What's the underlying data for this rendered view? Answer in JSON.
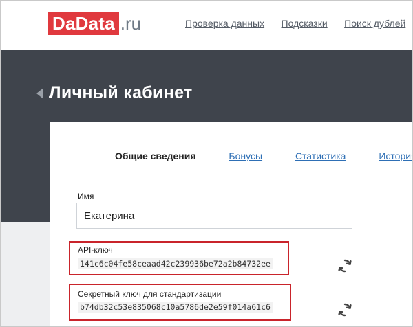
{
  "header": {
    "logo_main": "DaData",
    "logo_suffix": ".ru",
    "nav": [
      "Проверка данных",
      "Подсказки",
      "Поиск дублей"
    ]
  },
  "page": {
    "title": "Личный кабинет"
  },
  "tabs": [
    {
      "label": "Общие сведения",
      "active": true
    },
    {
      "label": "Бонусы",
      "active": false
    },
    {
      "label": "Статистика",
      "active": false
    },
    {
      "label": "История",
      "active": false
    }
  ],
  "form": {
    "name_label": "Имя",
    "name_value": "Екатерина",
    "api_key_label": "API-ключ",
    "api_key_value": "141c6c04fe58ceaad42c239936be72a2b84732ee",
    "secret_key_label": "Секретный ключ для стандартизации",
    "secret_key_value": "b74db32c53e835068c10a5786de2e59f014a61c6"
  },
  "colors": {
    "brand_red": "#e0393e",
    "dark_bg": "#3f444c",
    "link_blue": "#2e6fb5",
    "highlight_red": "#c9242b"
  },
  "icons": {
    "back": "back-arrow-icon",
    "refresh": "refresh-icon"
  }
}
